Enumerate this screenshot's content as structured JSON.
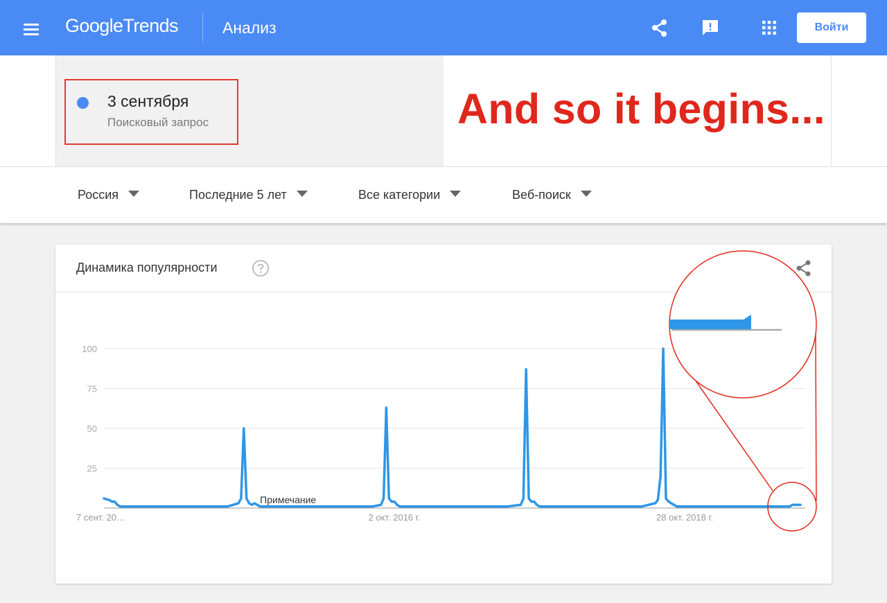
{
  "appbar": {
    "logo_google": "Google",
    "logo_trends": "Trends",
    "section_title": "Анализ",
    "login_label": "Войти",
    "icons": [
      "menu-icon",
      "share-icon",
      "feedback-icon",
      "apps-icon"
    ],
    "bar_color": "#4a8af4"
  },
  "comparison": {
    "term_name": "3 сентября",
    "term_type": "Поисковый запрос",
    "term_color": "#4a8af4",
    "overlay_caption": "And so it begins...",
    "overlay_color": "#e0271c"
  },
  "filters": [
    {
      "label": "Россия"
    },
    {
      "label": "Последние 5 лет"
    },
    {
      "label": "Все категории"
    },
    {
      "label": "Веб-поиск"
    }
  ],
  "card": {
    "title": "Динамика популярности",
    "help_icon": "help-icon",
    "share_icon": "share-icon"
  },
  "chart_data": {
    "type": "line",
    "title": "",
    "xlabel": "",
    "ylabel": "",
    "ylim": [
      0,
      100
    ],
    "yticks": [
      25,
      50,
      75,
      100
    ],
    "grid": true,
    "x_tick_labels": [
      {
        "label": "7 сент. 20…",
        "x": 0
      },
      {
        "label": "2 окт. 2016 г.",
        "x": 108
      },
      {
        "label": "28 окт. 2018 г.",
        "x": 216
      }
    ],
    "annotation": {
      "label": "Примечание",
      "x": 57
    },
    "series": [
      {
        "color": "#2e96e8",
        "x": [
          0,
          2,
          3,
          4,
          5,
          6,
          7,
          8,
          9,
          10,
          20,
          30,
          40,
          46,
          50,
          51,
          52,
          53,
          54,
          55,
          56,
          57,
          58,
          60,
          70,
          80,
          90,
          100,
          103,
          104,
          105,
          106,
          107,
          108,
          109,
          110,
          111,
          112,
          113,
          114,
          120,
          130,
          140,
          150,
          155,
          156,
          157,
          158,
          159,
          160,
          161,
          162,
          163,
          164,
          170,
          180,
          190,
          200,
          205,
          206,
          207,
          208,
          209,
          210,
          211,
          212,
          213,
          214,
          215,
          216,
          217,
          218,
          219,
          220,
          230,
          240,
          250,
          255,
          256,
          259
        ],
        "values": [
          6,
          5,
          4,
          4,
          2,
          1,
          1,
          1,
          1,
          1,
          1,
          1,
          1,
          1,
          3,
          6,
          50,
          6,
          3,
          2,
          3,
          2,
          1,
          1,
          1,
          1,
          1,
          1,
          2,
          6,
          63,
          6,
          4,
          4,
          2,
          1,
          1,
          1,
          1,
          1,
          1,
          1,
          1,
          1,
          2,
          6,
          87,
          6,
          4,
          4,
          2,
          1,
          1,
          1,
          1,
          1,
          1,
          1,
          3,
          5,
          20,
          100,
          6,
          4,
          3,
          2,
          1,
          1,
          1,
          1,
          1,
          1,
          1,
          1,
          1,
          1,
          1,
          1,
          2,
          2
        ]
      }
    ]
  }
}
